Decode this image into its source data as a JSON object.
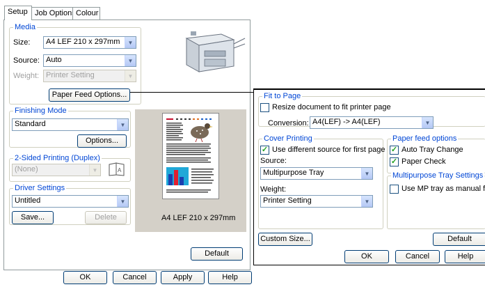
{
  "tabs": [
    {
      "label": "Setup"
    },
    {
      "label": "Job Options"
    },
    {
      "label": "Colour"
    }
  ],
  "media": {
    "group_label": "Media",
    "size_label": "Size:",
    "size_value": "A4 LEF 210 x 297mm",
    "source_label": "Source:",
    "source_value": "Auto",
    "weight_label": "Weight:",
    "weight_value": "Printer Setting",
    "paper_feed_button": "Paper Feed Options..."
  },
  "finishing": {
    "group_label": "Finishing Mode",
    "value": "Standard",
    "options_button": "Options..."
  },
  "duplex": {
    "group_label": "2-Sided Printing (Duplex)",
    "value": "(None)"
  },
  "driver": {
    "group_label": "Driver Settings",
    "value": "Untitled",
    "save_button": "Save...",
    "delete_button": "Delete"
  },
  "preview": {
    "caption": "A4 LEF 210 x 297mm",
    "default_button": "Default"
  },
  "dialog_buttons": {
    "ok": "OK",
    "cancel": "Cancel",
    "apply": "Apply",
    "help": "Help"
  },
  "popup": {
    "fit_group": "Fit to Page",
    "resize_label": "Resize document to fit printer page",
    "resize_checked": false,
    "conversion_label": "Conversion:",
    "conversion_value": "A4(LEF) -> A4(LEF)",
    "cover_group": "Cover Printing",
    "cover_checkbox": "Use different source for first page",
    "cover_checked": true,
    "source_label": "Source:",
    "source_value": "Multipurpose Tray",
    "weight_label": "Weight:",
    "weight_value": "Printer Setting",
    "feed_group": "Paper feed options",
    "auto_tray": "Auto Tray Change",
    "auto_tray_checked": true,
    "paper_check": "Paper Check",
    "paper_check_checked": true,
    "mp_group": "Multipurpose Tray Settings",
    "mp_manual": "Use MP tray as manual feed",
    "mp_manual_checked": false,
    "custom_size_button": "Custom Size...",
    "default_button": "Default",
    "ok_button": "OK",
    "cancel_button": "Cancel",
    "help_button": "Help"
  },
  "colors": {
    "group_label": "#0046d5",
    "check": "#21a121",
    "xp_border": "#003c74"
  }
}
